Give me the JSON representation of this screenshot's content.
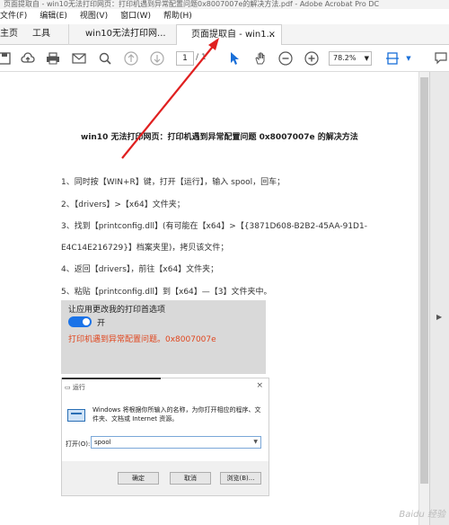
{
  "window": {
    "title": "页面提取自 - win10无法打印网页：打印机遇到异常配置问题0x8007007e的解决方法.pdf - Adobe Acrobat Pro DC"
  },
  "menu": [
    "文件(F)",
    "编辑(E)",
    "视图(V)",
    "窗口(W)",
    "帮助(H)"
  ],
  "tabs": {
    "home": "主页",
    "tools": "工具",
    "doc1": "win10无法打印网...",
    "doc2": "页面提取自 - win1...",
    "close": "×"
  },
  "toolbar": {
    "page_current": "1",
    "page_total": "/ 1",
    "zoom": "78.2%"
  },
  "document": {
    "title": "win10 无法打印网页：打印机遇到异常配置问题 0x8007007e 的解决方法",
    "steps": [
      "1、同时按【WIN+R】键，打开【运行】，输入 spool，回车；",
      "2、【drivers】>【x64】文件夹；",
      "3、找到【printconfig.dll】(有可能在【x64】>【{3871D608-B2B2-45AA-91D1-",
      "E4C14E216729}】档案夹里)，拷贝该文件；",
      "4、返回【drivers】，前往【x64】文件夹；",
      "5、粘贴【printconfig.dll】到【x64】—【3】文件夹中。"
    ],
    "image1": {
      "heading": "让应用更改我的打印首选项",
      "toggle_label": "开",
      "error": "打印机遇到异常配置问题。0x8007007e"
    },
    "image2": {
      "title": "运行",
      "close": "×",
      "description": "Windows 将根据你所输入的名称，为你打开相应的程序、文件夹、文档或 Internet 资源。",
      "open_label": "打开(O):",
      "open_value": "spool",
      "ok": "确定",
      "cancel": "取消",
      "browse": "浏览(B)..."
    }
  },
  "watermark": "Baidu 经验",
  "colors": {
    "annotation_arrow": "#e02020",
    "toggle_on": "#1a73e8",
    "error_text": "#e0461e",
    "pointer_tool": "#1a6fd8"
  },
  "icons": [
    "save-icon",
    "upload-icon",
    "print-icon",
    "email-icon",
    "search-icon",
    "page-up-icon",
    "page-down-icon",
    "select-pointer-icon",
    "hand-icon",
    "zoom-out-icon",
    "zoom-in-icon",
    "fit-page-icon",
    "comment-icon"
  ]
}
